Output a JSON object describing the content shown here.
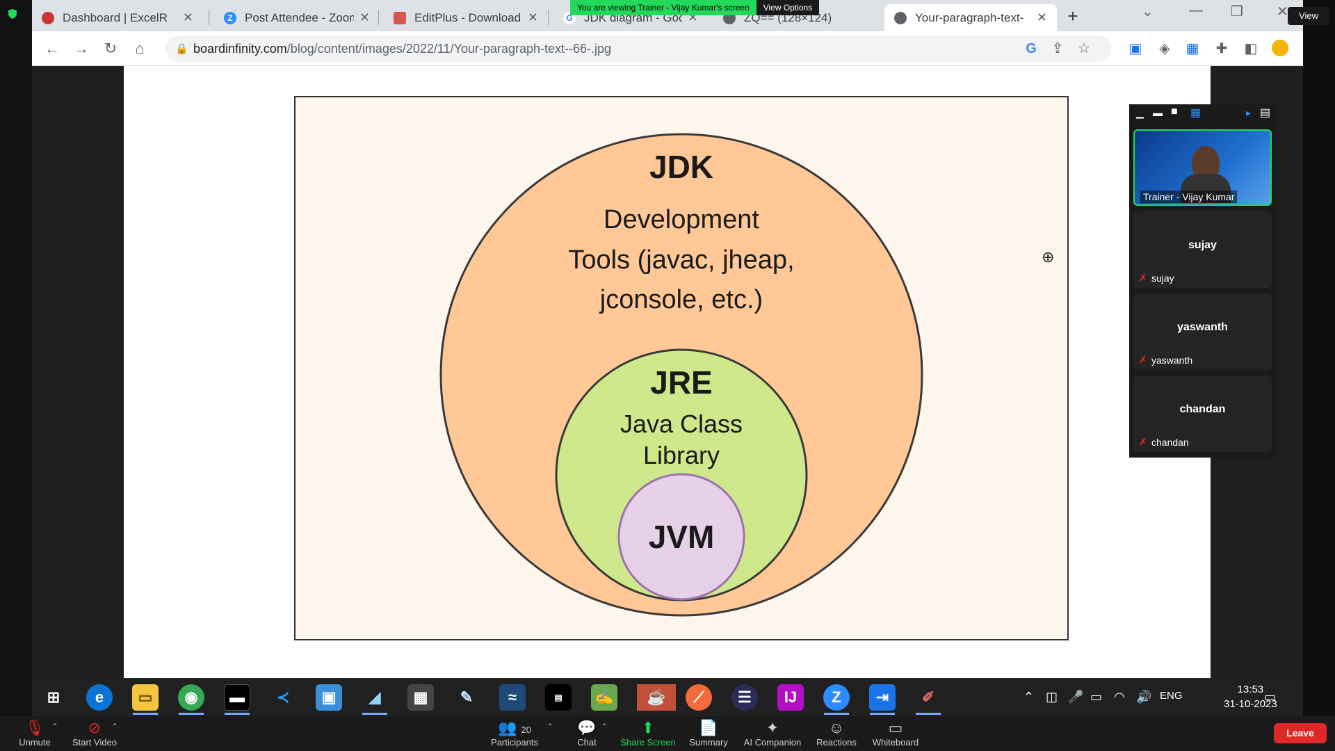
{
  "share_notice": {
    "message": "You are viewing Trainer - Vijay Kumar's screen",
    "options": "View Options"
  },
  "view_button": "View",
  "browser": {
    "tabs": [
      {
        "title": "Dashboard | ExcelR",
        "active": false
      },
      {
        "title": "Post Attendee - Zoom",
        "active": false
      },
      {
        "title": "EditPlus - Download",
        "active": false
      },
      {
        "title": "JDK diagram - Goog",
        "active": false
      },
      {
        "title": "ZQ== (128×124)",
        "active": false
      },
      {
        "title": "Your-paragraph-text-",
        "active": true
      }
    ],
    "url_host": "boardinfinity.com",
    "url_path": "/blog/content/images/2022/11/Your-paragraph-text--66-.jpg"
  },
  "diagram": {
    "jdk_title": "JDK",
    "jdk_line1": "Development",
    "jdk_line2": "Tools (javac, jheap,",
    "jdk_line3": "jconsole, etc.)",
    "jre_title": "JRE",
    "jre_line1": "Java Class",
    "jre_line2": "Library",
    "jvm_title": "JVM"
  },
  "gallery": {
    "tiles": [
      {
        "name": "Trainer - Vijay Kumar",
        "video": true
      },
      {
        "name": "sujay",
        "label": "sujay"
      },
      {
        "name": "yaswanth",
        "label": "yaswanth"
      },
      {
        "name": "chandan",
        "label": "chandan"
      }
    ]
  },
  "taskbar": {
    "lang": "ENG",
    "time": "13:53",
    "date": "31-10-2023"
  },
  "zoom": {
    "unmute": "Unmute",
    "start_video": "Start Video",
    "participants_count": "20",
    "participants": "Participants",
    "chat": "Chat",
    "share_screen": "Share Screen",
    "summary": "Summary",
    "ai_companion": "AI Companion",
    "reactions": "Reactions",
    "whiteboard": "Whiteboard",
    "leave": "Leave"
  }
}
